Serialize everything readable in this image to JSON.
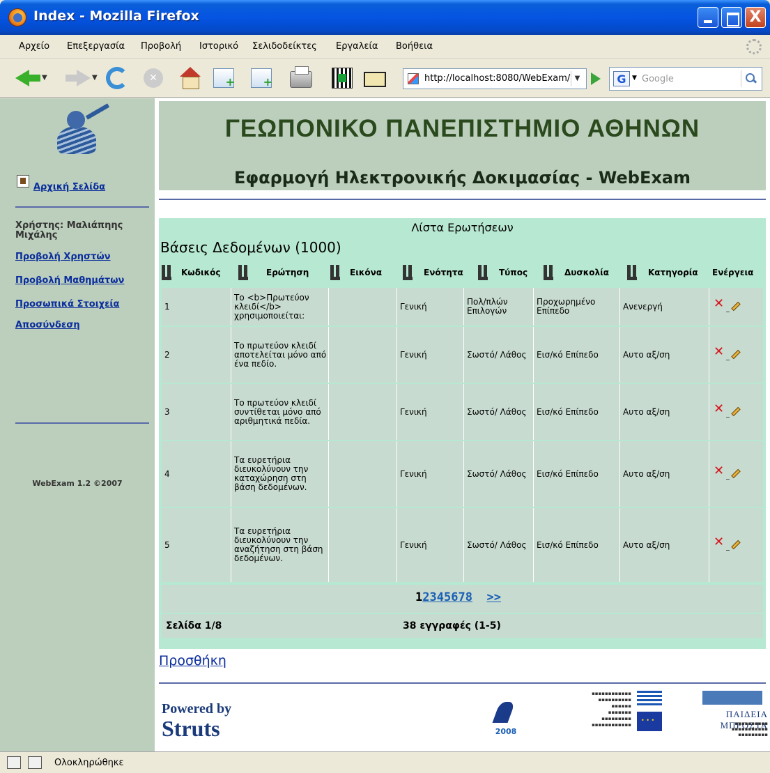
{
  "window": {
    "title": "Index - Mozilla Firefox",
    "close_glyph": "X"
  },
  "menu": [
    "Αρχείο",
    "Επεξεργασία",
    "Προβολή",
    "Ιστορικό",
    "Σελιδοδείκτες",
    "Εργαλεία",
    "Βοήθεια"
  ],
  "toolbar": {
    "url": "http://localhost:8080/WebExam/",
    "search_placeholder": "Google",
    "search_engine_glyph": "G"
  },
  "sidebar": {
    "home_link": "Αρχική Σελίδα",
    "user": "Χρήστης: Μαλιάπηης Μιχάλης",
    "links": [
      "Προβολή Χρηστών",
      "Προβολή Μαθημάτων",
      "Προσωπικά Στοιχεία",
      "Αποσύνδεση"
    ],
    "version": "WebExam 1.2 ©2007"
  },
  "header": {
    "university": "ΓΕΩΠΟΝΙΚΟ ΠΑΝΕΠΙΣΤΗΜΙΟ ΑΘΗΝΩΝ",
    "app": "Εφαρμογή Ηλεκτρονικής Δοκιμασίας - WebExam"
  },
  "list": {
    "title": "Λίστα Ερωτήσεων",
    "subtitle": "Βάσεις Δεδομένων (1000)",
    "columns": [
      "Κωδικός",
      "Ερώτηση",
      "Εικόνα",
      "Ενότητα",
      "Τύπος",
      "Δυσκολία",
      "Κατηγορία",
      "Ενέργεια"
    ],
    "rows": [
      {
        "code": "1",
        "question": "Το <b>Πρωτεύον κλειδί</b> χρησιμοποιείται:",
        "image": "",
        "section": "Γενική",
        "type": "Πολ/πλών Επιλογών",
        "difficulty": "Προχωρημένο Επίπεδο",
        "category": "Ανενεργή"
      },
      {
        "code": "2",
        "question": "Το πρωτεύον κλειδί αποτελείται μόνο από ένα πεδίο.",
        "image": "",
        "section": "Γενική",
        "type": "Σωστό/ Λάθος",
        "difficulty": "Εισ/κό Επίπεδο",
        "category": "Αυτο αξ/ση"
      },
      {
        "code": "3",
        "question": "Το πρωτεύον κλειδί συντίθεται μόνο από αριθμητικά πεδία.",
        "image": "",
        "section": "Γενική",
        "type": "Σωστό/ Λάθος",
        "difficulty": "Εισ/κό Επίπεδο",
        "category": "Αυτο αξ/ση"
      },
      {
        "code": "4",
        "question": "Τα ευρετήρια διευκολύνουν την καταχώρηση στη βάση δεδομένων.",
        "image": "",
        "section": "Γενική",
        "type": "Σωστό/ Λάθος",
        "difficulty": "Εισ/κό Επίπεδο",
        "category": "Αυτο αξ/ση"
      },
      {
        "code": "5",
        "question": "Τα ευρετήρια διευκολύνουν την αναζήτηση στη βάση δεδομένων.",
        "image": "",
        "section": "Γενική",
        "type": "Σωστό/ Λάθος",
        "difficulty": "Εισ/κό Επίπεδο",
        "category": "Αυτο αξ/ση"
      }
    ],
    "delete_glyph": "✕",
    "pager": {
      "current": "1",
      "pages": [
        "2",
        "3",
        "4",
        "5",
        "6",
        "7",
        "8"
      ],
      "next": ">>"
    },
    "page_info": "Σελίδα 1/8",
    "records_info": "38 εγγραφές (1-5)"
  },
  "add_link": "Προσθήκη",
  "footer": {
    "powered_line1": "Powered by",
    "powered_line2": "Struts",
    "logo_2008": "2008",
    "paideia": "ΠΑΙΔΕΙΑ ΜΠΡΟΣΤΑ"
  },
  "status": {
    "text": "Ολοκληρώθηκε"
  },
  "colors": {
    "sidebar_bg": "#bccfbc",
    "panel_bg": "#b7e8d1",
    "row_bg": "#c8dbd0",
    "link": "#0a2d9c",
    "title_green": "#2a4a1e"
  }
}
